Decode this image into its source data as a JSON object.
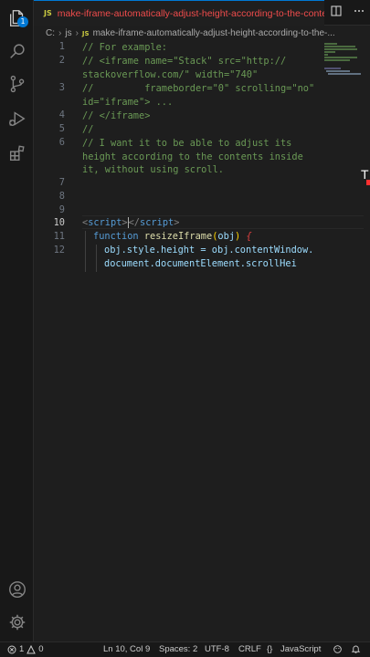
{
  "tab": {
    "lang_badge": "JS",
    "title": "make-iframe-automatically-adjust-height-according-to-the-conte",
    "split_icon": "split-editor-icon",
    "more_icon": "more-actions-icon"
  },
  "breadcrumb": {
    "drive": "C:",
    "folder": "js",
    "lang_badge": "JS",
    "file": "make-iframe-automatically-adjust-height-according-to-the-..."
  },
  "activity_bar": {
    "explorer_badge": "1",
    "icons": [
      "explorer-icon",
      "search-icon",
      "source-control-icon",
      "run-debug-icon",
      "extensions-icon",
      "account-icon",
      "settings-gear-icon"
    ]
  },
  "editor": {
    "line_numbers": [
      "1",
      "2",
      "3",
      "4",
      "5",
      "6",
      "7",
      "8",
      "9",
      "10",
      "11",
      "12"
    ],
    "active_line": "10",
    "lines": {
      "l1": "// For example:",
      "l2a": "// <iframe name=\"Stack\" src=\"http://",
      "l2b": "stackoverflow.com/\" width=\"740\"",
      "l3a": "//         frameborder=\"0\" scrolling=\"no\"",
      "l3b": "id=\"iframe\"> ...",
      "l4": "// </iframe>",
      "l5": "//",
      "l6a": "// I want it to be able to adjust its",
      "l6b": "height according to the contents inside",
      "l6c": "it, without using scroll.",
      "l10_open_lt": "<",
      "l10_open_tag": "script",
      "l10_open_gt": ">",
      "l10_close_lt": "</",
      "l10_close_tag": "script",
      "l10_close_gt": ">",
      "l11_kw": "function",
      "l11_fn": "resizeIframe",
      "l11_paren_open": "(",
      "l11_param": "obj",
      "l11_paren_close": ")",
      "l11_annot": "{",
      "l12a_obj": "obj",
      "l12a_rest": ".style.height = obj.contentWindow.",
      "l12b": "document.documentElement.scrollHei"
    },
    "peek_text": "T"
  },
  "status_bar": {
    "errors": "1",
    "warnings": "0",
    "position": "Ln 10, Col 9",
    "spaces": "Spaces: 2",
    "encoding": "UTF-8",
    "eol": "CRLF",
    "braces": "{}",
    "language": "JavaScript"
  },
  "colors": {
    "accent": "#0078d4",
    "tab_title": "#f14c4c",
    "comment": "#6a9955",
    "keyword": "#569cd6",
    "function": "#dcdcaa",
    "variable": "#9cdcfe"
  }
}
